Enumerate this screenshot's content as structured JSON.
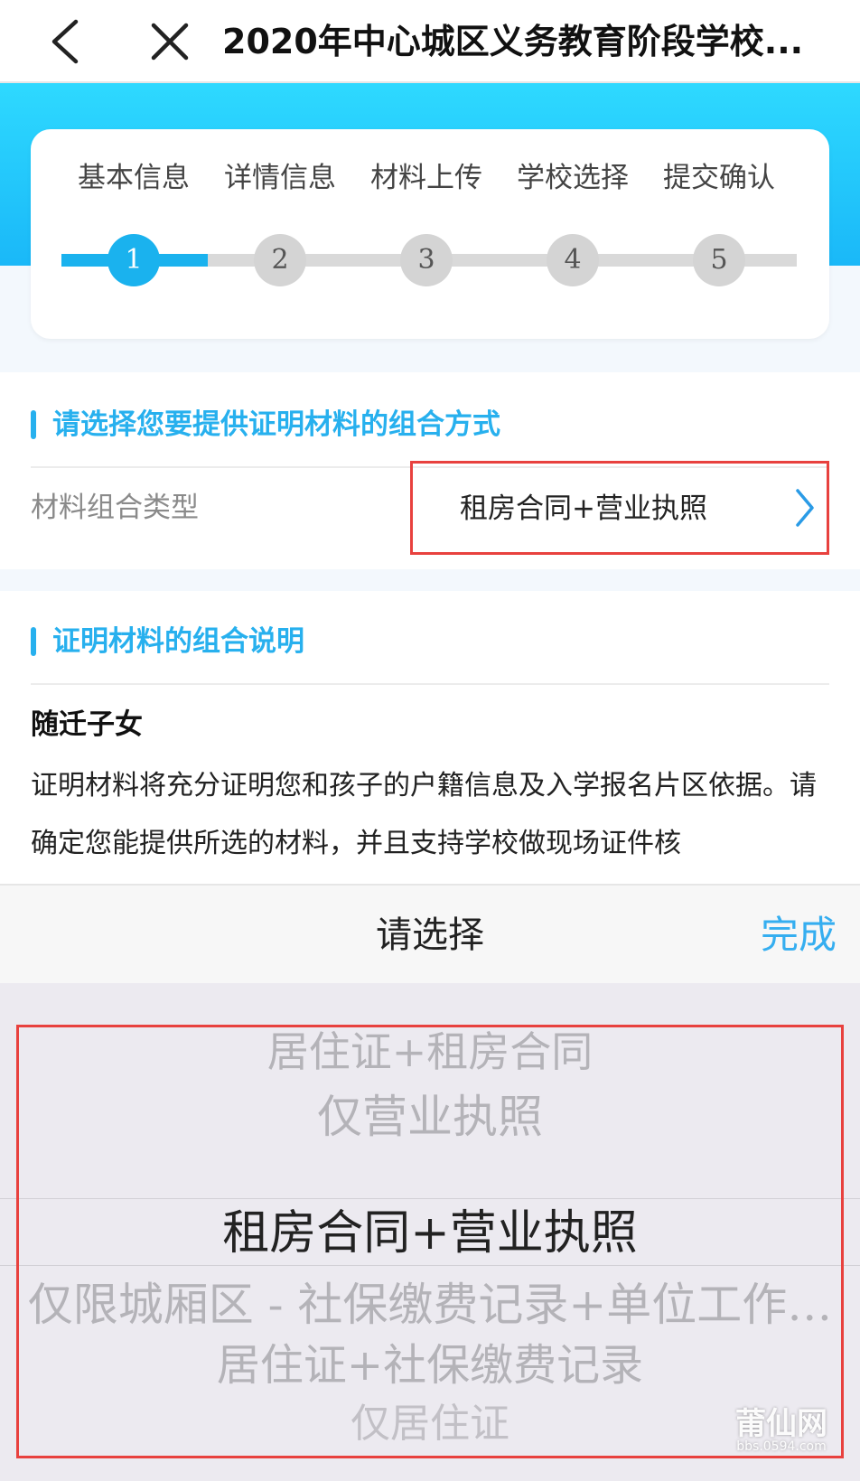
{
  "header": {
    "back_icon": "chevron-left-icon",
    "close_icon": "close-icon",
    "title": "2020年中心城区义务教育阶段学校..."
  },
  "steps": [
    {
      "label": "基本信息",
      "number": "1",
      "active": true
    },
    {
      "label": "详情信息",
      "number": "2",
      "active": false
    },
    {
      "label": "材料上传",
      "number": "3",
      "active": false
    },
    {
      "label": "学校选择",
      "number": "4",
      "active": false
    },
    {
      "label": "提交确认",
      "number": "5",
      "active": false
    }
  ],
  "section1": {
    "heading": "请选择您要提供证明材料的组合方式",
    "row_label": "材料组合类型",
    "row_value": "租房合同+营业执照"
  },
  "section2": {
    "heading": "证明材料的组合说明",
    "item_title": "随迁子女",
    "item_desc": "证明材料将充分证明您和孩子的户籍信息及入学报名片区依据。请确定您能提供所选的材料，并且支持学校做现场证件核"
  },
  "picker": {
    "title": "请选择",
    "done_label": "完成",
    "selected_index": 2,
    "options": [
      "居住证+租房合同",
      "仅营业执照",
      "租房合同+营业执照",
      "仅限城厢区 - 社保缴费记录+单位工作…",
      "居住证+社保缴费记录",
      "仅居住证"
    ]
  },
  "watermark": {
    "brand": "莆仙网",
    "url": "bbs.0594.com"
  },
  "colors": {
    "accent": "#1ab2ee",
    "highlight_border": "#e8413e"
  }
}
